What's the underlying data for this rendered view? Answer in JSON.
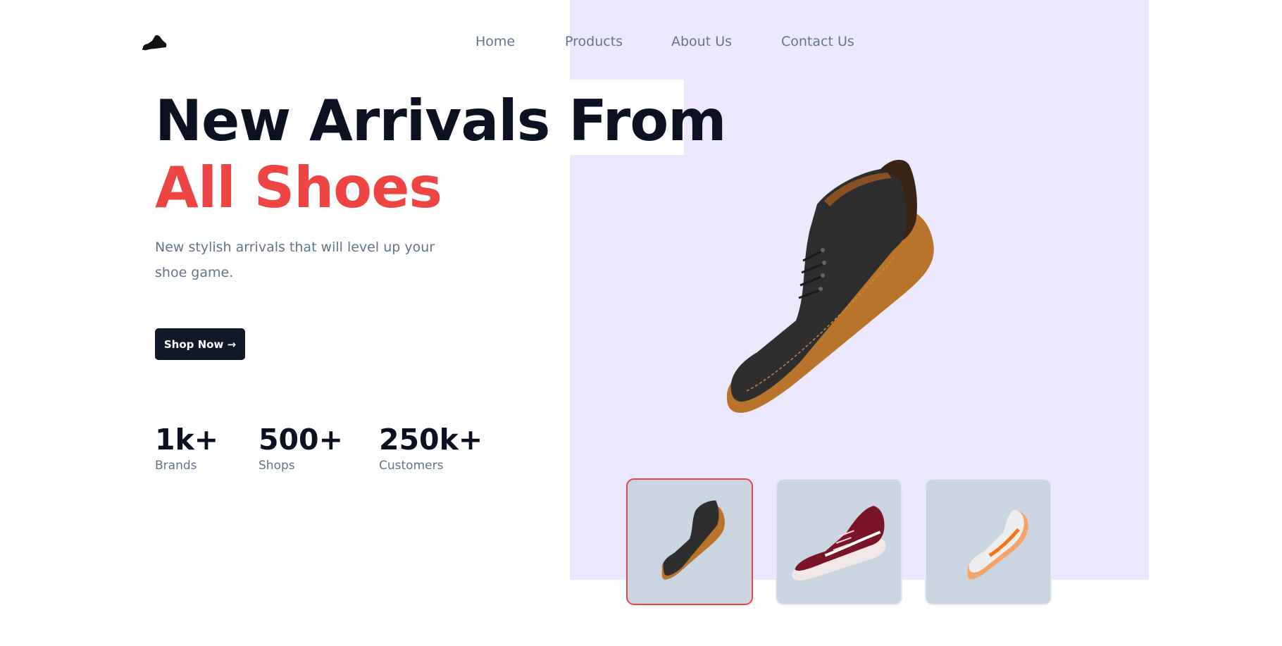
{
  "brand": {
    "logo_icon": "sneaker-icon"
  },
  "nav": {
    "items": [
      {
        "label": "Home"
      },
      {
        "label": "Products"
      },
      {
        "label": "About Us"
      },
      {
        "label": "Contact Us"
      }
    ]
  },
  "hero": {
    "title_line1": "New Arrivals From",
    "title_line2": "All Shoes",
    "subtitle": "New stylish arrivals that will level up your shoe game.",
    "cta_label": "Shop Now →",
    "main_image_icon": "dark-chukka-boot-image"
  },
  "stats": [
    {
      "value": "1k+",
      "label": "Brands"
    },
    {
      "value": "500+",
      "label": "Shops"
    },
    {
      "value": "250k+",
      "label": "Customers"
    }
  ],
  "thumbnails": [
    {
      "icon": "dark-boot-thumbnail",
      "selected": true
    },
    {
      "icon": "maroon-sneaker-thumbnail",
      "selected": false
    },
    {
      "icon": "white-orange-sneaker-thumbnail",
      "selected": false
    }
  ],
  "colors": {
    "accent": "#ef4444",
    "heading": "#0b1120",
    "muted": "#64748b",
    "hero_panel": "#ece9ff",
    "button": "#111827",
    "thumbnail_bg": "#cbd5e1"
  }
}
